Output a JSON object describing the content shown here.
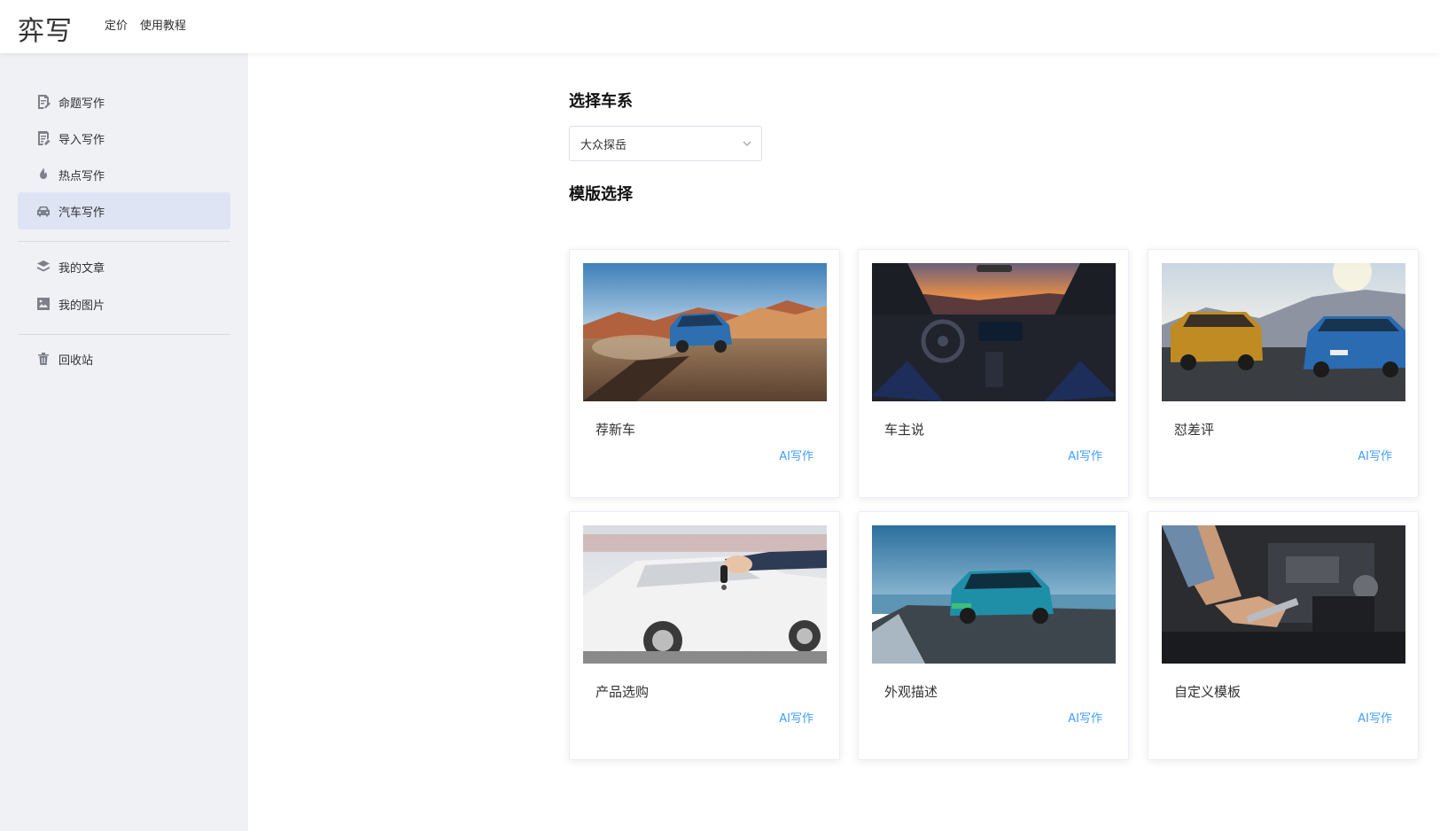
{
  "header": {
    "logo": "弈写",
    "nav": [
      "定价",
      "使用教程"
    ]
  },
  "sidebar": {
    "items": [
      {
        "label": "命题写作",
        "icon": "document-edit-icon"
      },
      {
        "label": "导入写作",
        "icon": "document-import-icon"
      },
      {
        "label": "热点写作",
        "icon": "flame-icon"
      },
      {
        "label": "汽车写作",
        "icon": "car-icon",
        "active": true
      },
      {
        "label": "我的文章",
        "icon": "layers-icon"
      },
      {
        "label": "我的图片",
        "icon": "image-icon"
      },
      {
        "label": "回收站",
        "icon": "trash-icon"
      }
    ]
  },
  "main": {
    "series_title": "选择车系",
    "series_select": {
      "value": "大众探岳"
    },
    "template_title": "模版选择",
    "action_label": "AI写作",
    "cards": [
      {
        "name": "荐新车"
      },
      {
        "name": "车主说"
      },
      {
        "name": "怼差评"
      },
      {
        "name": "产品选购"
      },
      {
        "name": "外观描述"
      },
      {
        "name": "自定义模板"
      }
    ]
  },
  "colors": {
    "accent": "#409eff",
    "sidebar_bg": "#eff1f5",
    "active_bg": "#dee4f3"
  }
}
